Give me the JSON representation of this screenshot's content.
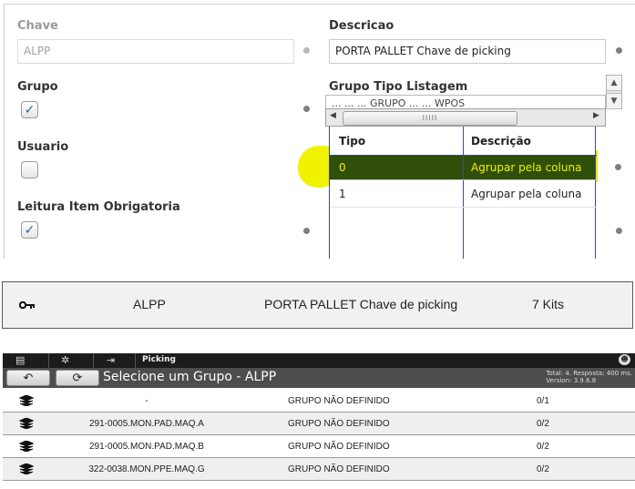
{
  "form": {
    "chave_label": "Chave",
    "chave_value": "ALPP",
    "descricao_label": "Descricao",
    "descricao_value": "PORTA PALLET Chave de picking",
    "grupo_label": "Grupo",
    "grupo_checked": true,
    "grupo_tipo_listagem_label": "Grupo Tipo Listagem",
    "combo_partial_text": "...       ... ... GRUPO ... ... WPOS",
    "usuario_label": "Usuario",
    "usuario_checked": false,
    "leitura_label": "Leitura Item Obrigatoria",
    "leitura_checked": true,
    "grid": {
      "headers": [
        "Tipo",
        "Descrição"
      ],
      "rows": [
        {
          "tipo": "0",
          "descricao": "Agrupar pela coluna",
          "selected": true
        },
        {
          "tipo": "1",
          "descricao": "Agrupar pela coluna",
          "selected": false
        }
      ]
    }
  },
  "record": {
    "key_icon": "key-icon",
    "chave": "ALPP",
    "descricao": "PORTA PALLET Chave de picking",
    "kits": "7 Kits"
  },
  "app": {
    "topbar": {
      "icons": [
        "list-icon",
        "gear-icon",
        "login-icon"
      ],
      "title": "Picking"
    },
    "screen_title": "Selecione um Grupo - ALPP",
    "status_line1": "Total: 4. Resposta: 400 ms.",
    "status_line2": "Version: 3.9.6.8",
    "rows": [
      {
        "code": "-",
        "group": "GRUPO NÃO DEFINIDO",
        "count": "0/1"
      },
      {
        "code": "291-0005.MON.PAD.MAQ.A",
        "group": "GRUPO NÃO DEFINIDO",
        "count": "0/2"
      },
      {
        "code": "291-0005.MON.PAD.MAQ.B",
        "group": "GRUPO NÃO DEFINIDO",
        "count": "0/2"
      },
      {
        "code": "322-0038.MON.PPE.MAQ.G",
        "group": "GRUPO NÃO DEFINIDO",
        "count": "0/2"
      }
    ]
  },
  "colors": {
    "selection_bg": "#2f4f0a",
    "selection_text": "#f1f200",
    "marker": "#f1f200",
    "grid_border": "#3a4f80",
    "app_topbar": "#1c1c1c",
    "app_titlebar": "#4d4d4d"
  }
}
